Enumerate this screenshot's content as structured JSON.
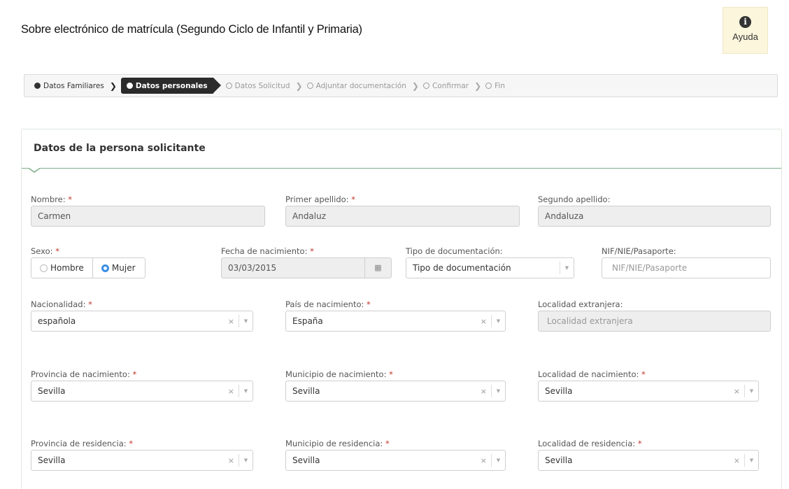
{
  "page": {
    "title": "Sobre electrónico de matrícula (Segundo Ciclo de Infantil y Primaria)",
    "help_label": "Ayuda",
    "help_icon": "info-icon"
  },
  "steps": [
    {
      "label": "Datos Familiares",
      "state": "done"
    },
    {
      "label": "Datos personales",
      "state": "active"
    },
    {
      "label": "Datos Solicitud",
      "state": "todo"
    },
    {
      "label": "Adjuntar documentación",
      "state": "todo"
    },
    {
      "label": "Confirmar",
      "state": "todo"
    },
    {
      "label": "Fin",
      "state": "todo"
    }
  ],
  "card": {
    "title": "Datos de la persona solicitante"
  },
  "required_mark": "*",
  "fields": {
    "nombre": {
      "label": "Nombre:",
      "value": "Carmen"
    },
    "primer_apellido": {
      "label": "Primer apellido:",
      "value": "Andaluz"
    },
    "segundo_apellido": {
      "label": "Segundo apellido:",
      "value": "Andaluza"
    },
    "sexo": {
      "label": "Sexo:",
      "options": [
        "Hombre",
        "Mujer"
      ],
      "selected": "Mujer"
    },
    "fecha_nacimiento": {
      "label": "Fecha de nacimiento:",
      "value": "03/03/2015"
    },
    "tipo_documentacion": {
      "label": "Tipo de documentación:",
      "value": "Tipo de documentación"
    },
    "nif": {
      "label": "NIF/NIE/Pasaporte:",
      "placeholder": "NIF/NIE/Pasaporte"
    },
    "nacionalidad": {
      "label": "Nacionalidad:",
      "value": "española"
    },
    "pais_nacimiento": {
      "label": "País de nacimiento:",
      "value": "España"
    },
    "localidad_extranjera": {
      "label": "Localidad extranjera:",
      "placeholder": "Localidad extranjera"
    },
    "provincia_nacimiento": {
      "label": "Provincia de nacimiento:",
      "value": "Sevilla"
    },
    "municipio_nacimiento": {
      "label": "Municipio de nacimiento:",
      "value": "Sevilla"
    },
    "localidad_nacimiento": {
      "label": "Localidad de nacimiento:",
      "value": "Sevilla"
    },
    "provincia_residencia": {
      "label": "Provincia de residencia:",
      "value": "Sevilla"
    },
    "municipio_residencia": {
      "label": "Municipio de residencia:",
      "value": "Sevilla"
    },
    "localidad_residencia": {
      "label": "Localidad de residencia:",
      "value": "Sevilla"
    }
  },
  "glyphs": {
    "clear": "×",
    "arrow": "▼",
    "calendar": "▦",
    "sep": "❯"
  }
}
